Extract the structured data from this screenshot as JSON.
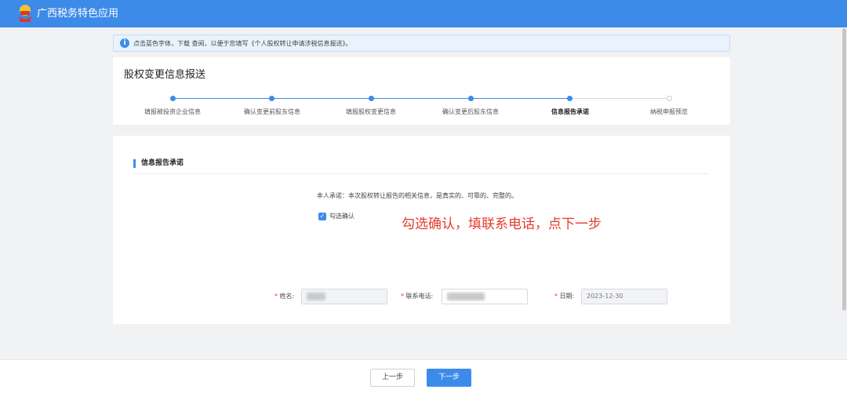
{
  "app": {
    "title": "广西税务特色应用"
  },
  "notice": {
    "icon": "info-icon",
    "text": "点击蓝色字体，下载 查阅，以便于您填写《个人股权转让申请涉税信息报送》。"
  },
  "page": {
    "title": "股权变更信息报送"
  },
  "steps": [
    {
      "label": "填报被投资企业信息",
      "status": "done"
    },
    {
      "label": "确认变更前股东信息",
      "status": "done"
    },
    {
      "label": "填报股权变更信息",
      "status": "done"
    },
    {
      "label": "确认变更后股东信息",
      "status": "done"
    },
    {
      "label": "信息报告承诺",
      "status": "current"
    },
    {
      "label": "纳税申报预览",
      "status": "pending"
    }
  ],
  "section": {
    "title": "信息报告承诺"
  },
  "pledge": {
    "text": "本人承诺：本次股权转让报告的相关信息，是真实的、可靠的、完整的。",
    "checkbox_label": "勾选确认",
    "checked": true
  },
  "hint": "勾选确认，填联系电话，点下一步",
  "form": {
    "required_mark": "*",
    "name_label": "姓名:",
    "phone_label": "联系电话:",
    "date_label": "日期:",
    "date_value": "2023-12-30"
  },
  "footer": {
    "prev_label": "上一步",
    "next_label": "下一步"
  },
  "colors": {
    "primary": "#3d8be8",
    "hint": "#e53b2e",
    "background": "#f1f2f4"
  }
}
